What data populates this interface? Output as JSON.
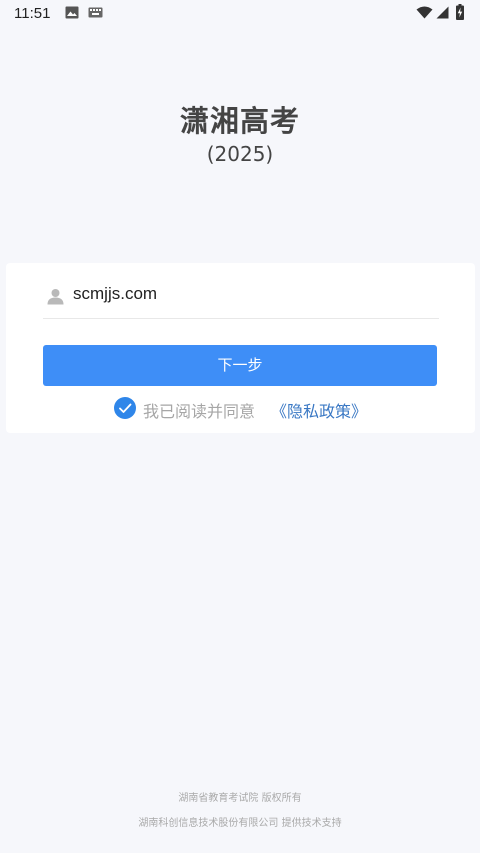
{
  "status_bar": {
    "time": "11:51",
    "icons": [
      "image-icon",
      "keyboard-icon",
      "wifi-icon",
      "signal-icon",
      "battery-charging-icon"
    ]
  },
  "app": {
    "title": "潇湘高考",
    "subtitle": "(2025)"
  },
  "login_card": {
    "account": "scmjjs.com",
    "account_icon": "user-icon",
    "next_button_label": "下一步",
    "agree_text": "我已阅读并同意",
    "policy_link": "《隐私政策》",
    "checkbox_checked": true,
    "accent_color": "#3e8ef7"
  },
  "footer": {
    "line1": "湖南省教育考试院 版权所有",
    "line2": "湖南科创信息技术股份有限公司 提供技术支持"
  }
}
